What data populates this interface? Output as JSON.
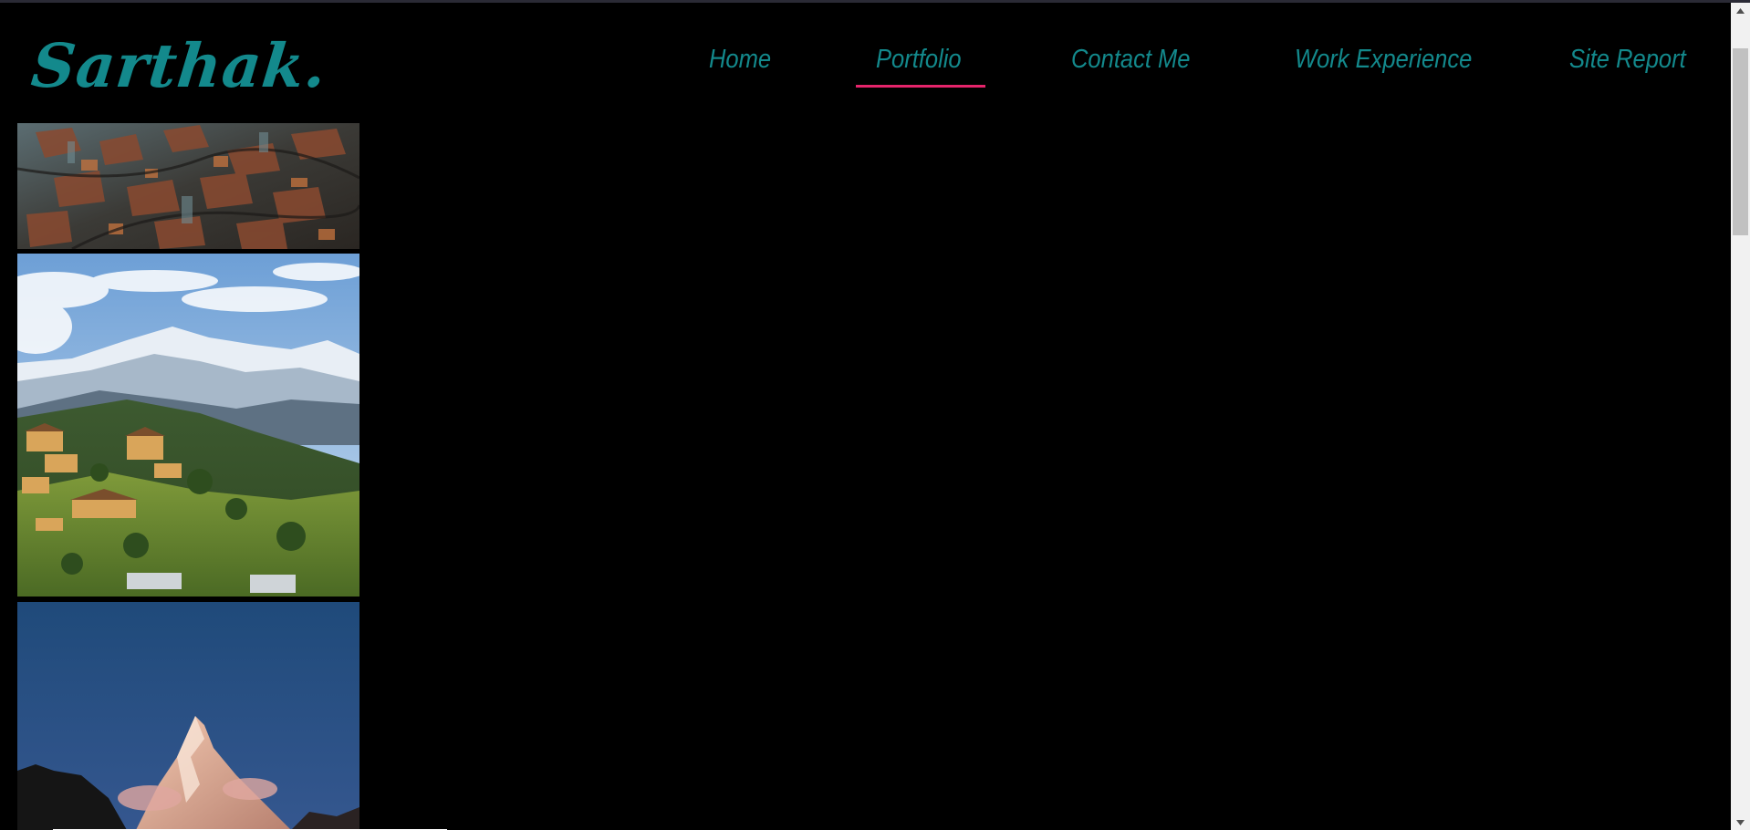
{
  "header": {
    "logo_text": "Sarthak."
  },
  "nav": {
    "items": [
      {
        "label": "Home",
        "active": false
      },
      {
        "label": "Portfolio",
        "active": true
      },
      {
        "label": "Contact Me",
        "active": false
      },
      {
        "label": "Work Experience",
        "active": false
      },
      {
        "label": "Site Report",
        "active": false
      }
    ]
  },
  "gallery": {
    "images": [
      {
        "name": "aerial-rooftops-photo"
      },
      {
        "name": "mountain-village-photo"
      },
      {
        "name": "snowy-peak-photo"
      }
    ]
  },
  "colors": {
    "background": "#000000",
    "accent": "#13898c",
    "active_underline": "#e5246b"
  }
}
